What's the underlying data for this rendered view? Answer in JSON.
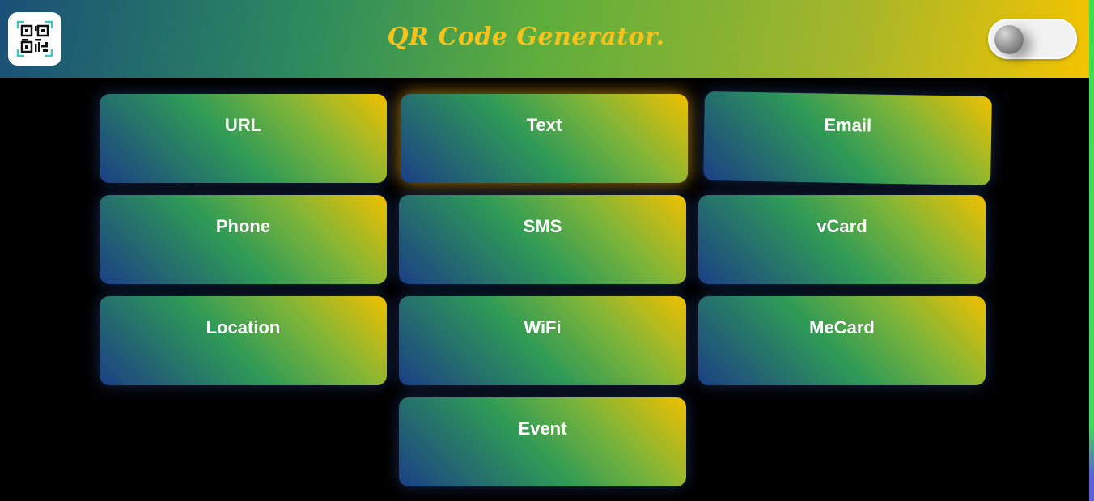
{
  "header": {
    "title": "QR Code Generator.",
    "logo_icon": "qr-code-icon",
    "theme_toggle": "toggle-switch"
  },
  "colors": {
    "title": "#f6c21c",
    "background": "#000000",
    "gradient_start": "#1b3f86",
    "gradient_mid": "#2e9a57",
    "gradient_end": "#f1c000"
  },
  "cards": [
    {
      "label": "URL"
    },
    {
      "label": "Text"
    },
    {
      "label": "Email"
    },
    {
      "label": "Phone"
    },
    {
      "label": "SMS"
    },
    {
      "label": "vCard"
    },
    {
      "label": "Location"
    },
    {
      "label": "WiFi"
    },
    {
      "label": "MeCard"
    },
    {
      "label": "Event"
    }
  ]
}
